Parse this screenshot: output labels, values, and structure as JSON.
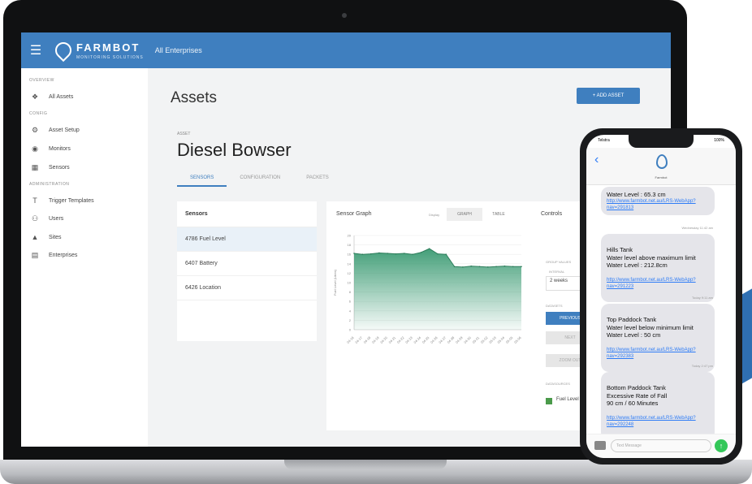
{
  "app": {
    "brand": "FARMBOT",
    "brand_sub": "MONITORING SOLUTIONS",
    "org": "All Enterprises",
    "colors": {
      "primary": "#3f7fbf",
      "series": "#3a9a72",
      "imessage_blue": "#2e7cf6"
    }
  },
  "sidebar": {
    "overview_section": "OVERVIEW",
    "overview_items": [
      {
        "icon": "compass-icon",
        "label": "All Assets"
      }
    ],
    "config_section": "CONFIG",
    "config_items": [
      {
        "icon": "gear-icon",
        "label": "Asset Setup"
      },
      {
        "icon": "monitor-icon",
        "label": "Monitors"
      },
      {
        "icon": "sensor-icon",
        "label": "Sensors"
      }
    ],
    "admin_section": "ADMINISTRATION",
    "admin_items": [
      {
        "icon": "trigger-icon",
        "label": "Trigger Templates"
      },
      {
        "icon": "users-icon",
        "label": "Users"
      },
      {
        "icon": "pin-icon",
        "label": "Sites"
      },
      {
        "icon": "building-icon",
        "label": "Enterprises"
      }
    ]
  },
  "main": {
    "title": "Assets",
    "add_button": "+ ADD ASSET",
    "asset_label": "Asset",
    "asset_name": "Diesel Bowser",
    "tabs": [
      "SENSORS",
      "CONFIGURATION",
      "PACKETS"
    ],
    "sensors_header": "Sensors",
    "sensors": [
      "4786 Fuel Level",
      "6407 Battery",
      "6426 Location"
    ],
    "graph": {
      "title": "Sensor Graph",
      "display_label": "Display",
      "toggle": [
        "GRAPH",
        "TABLE"
      ],
      "y_axis_label": "Fuel Level (Litres)"
    },
    "controls": {
      "title": "Controls",
      "group_label": "Group values",
      "interval_label": "Interval",
      "interval_value": "2 weeks",
      "dataset_label": "Datasets",
      "btn_primary": "PREVIOUS",
      "btn_next": "NEXT",
      "btn_zoom": "ZOOM OUT",
      "datasources_label": "Datasources",
      "checkbox_label": "Fuel Level"
    }
  },
  "chart_data": {
    "type": "area",
    "title": "Sensor Graph",
    "xlabel": "",
    "ylabel": "Fuel Level (Litres)",
    "x": [
      "04-16",
      "04-17",
      "04-18",
      "04-19",
      "04-20",
      "04-21",
      "04-22",
      "04-23",
      "04-24",
      "04-25",
      "04-26",
      "04-27",
      "04-28",
      "04-29",
      "04-30",
      "05-01",
      "05-02",
      "05-03",
      "05-04",
      "05-05",
      "05-06"
    ],
    "series": [
      {
        "values": [
          16.2,
          16.0,
          16.1,
          16.3,
          16.2,
          16.1,
          16.2,
          16.0,
          16.4,
          17.2,
          16.1,
          16.0,
          13.4,
          13.3,
          13.5,
          13.4,
          13.3,
          13.4,
          13.5,
          13.4,
          13.4
        ]
      }
    ],
    "yticks": [
      0,
      2,
      4,
      6,
      8,
      10,
      12,
      14,
      16,
      18,
      20
    ],
    "ylim": [
      0,
      20
    ],
    "grid": true
  },
  "phone": {
    "status_left": "Telstra",
    "status_right": "100%",
    "contact": "Farmbot",
    "messages": [
      {
        "text": "Water Level : 65.3 cm",
        "link": "http://www.farmbot.net.au/LRS-WebApp?nav=291813"
      },
      {
        "timestamp": "Wednesday 11:42 am"
      },
      {
        "text": "Hills Tank\nWater level above maximum limit\nWater Level : 212.8cm",
        "link": "http://www.farmbot.net.au/LRS-WebApp?nav=291223"
      },
      {
        "timestamp": "Today 9:11 am"
      },
      {
        "text": "Top Paddock Tank\nWater level below minimum limit\nWater Level : 50 cm",
        "link": "http://www.farmbot.net.au/LRS-WebApp?nav=292383"
      },
      {
        "timestamp": "Today 2:47 pm"
      },
      {
        "text": "Bottom Paddock Tank\nExcessive Rate of Fall\n90 cm / 60 Minutes",
        "link": "http://www.farmbot.net.au/LRS-WebApp?nav=292248"
      }
    ],
    "input_placeholder": "Text Message",
    "send_icon": "arrow-up-icon"
  }
}
